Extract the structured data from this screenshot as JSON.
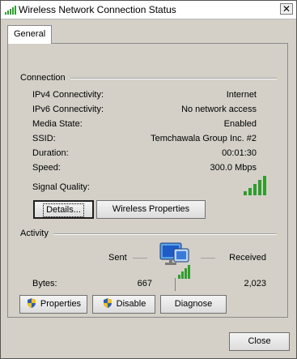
{
  "window": {
    "title": "Wireless Network Connection Status",
    "close_glyph": "✕"
  },
  "tabs": [
    {
      "label": "General"
    }
  ],
  "connection": {
    "section_title": "Connection",
    "rows": [
      {
        "label": "IPv4 Connectivity:",
        "value": "Internet"
      },
      {
        "label": "IPv6 Connectivity:",
        "value": "No network access"
      },
      {
        "label": "Media State:",
        "value": "Enabled"
      },
      {
        "label": "SSID:",
        "value": "Temchawala Group Inc. #2"
      },
      {
        "label": "Duration:",
        "value": "00:01:30"
      },
      {
        "label": "Speed:",
        "value": "300.0 Mbps"
      }
    ],
    "signal_label": "Signal Quality:",
    "signal_bars_active": 5,
    "signal_bars_total": 5
  },
  "buttons": {
    "details": "Details...",
    "wireless_properties": "Wireless Properties",
    "properties": "Properties",
    "disable": "Disable",
    "diagnose": "Diagnose",
    "close": "Close"
  },
  "activity": {
    "section_title": "Activity",
    "sent_label": "Sent",
    "received_label": "Received",
    "bytes_label": "Bytes:",
    "bytes_sent": "667",
    "bytes_received": "2,023"
  },
  "icons": {
    "title": "wifi-signal-icon",
    "network": "computer-network-icon",
    "shield": "uac-shield-icon"
  },
  "colors": {
    "signal_green": "#2e9e2e",
    "shield_blue": "#2f5fb3",
    "shield_yellow": "#f2c21b"
  }
}
